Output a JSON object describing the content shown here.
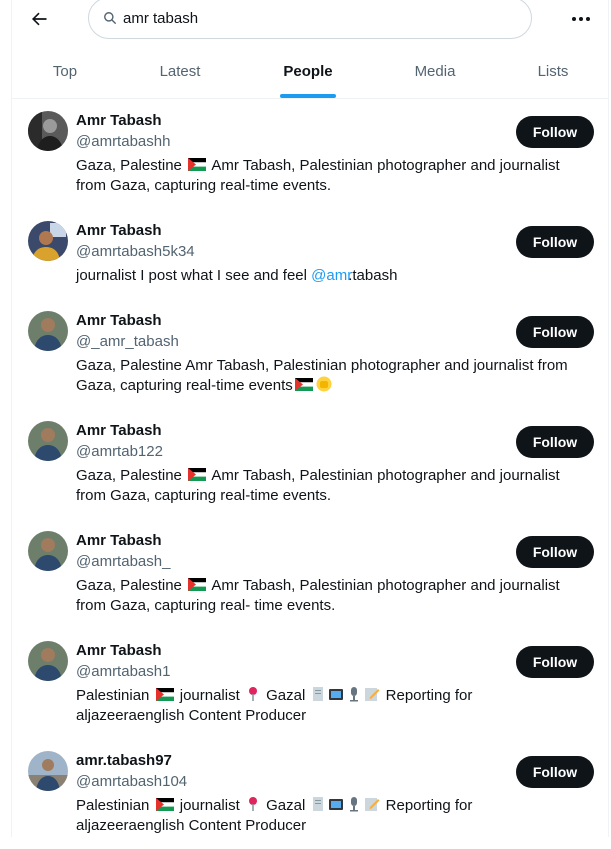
{
  "search": {
    "value": "amr tabash"
  },
  "tabs": [
    {
      "label": "Top",
      "active": false
    },
    {
      "label": "Latest",
      "active": false
    },
    {
      "label": "People",
      "active": true
    },
    {
      "label": "Media",
      "active": false
    },
    {
      "label": "Lists",
      "active": false
    }
  ],
  "colors": {
    "accent": "#1d9bf0",
    "text": "#0f1419",
    "muted": "#536471",
    "button": "#0f1419"
  },
  "icons": {
    "back": "arrow-left-icon",
    "search": "search-icon",
    "more": "more-horizontal-icon"
  },
  "people": [
    {
      "name": "Amr Tabash",
      "handle": "@amrtabashh",
      "button": "Follow",
      "bio_a": "Gaza, Palestine",
      "bio_b": "Amr Tabash, Palestinian photographer and journalist",
      "bio_c": "from Gaza, capturing real-time events."
    },
    {
      "name": "Amr Tabash",
      "handle": "@amrtabash5k34",
      "button": "Follow",
      "bio_a": "journalist I post what I see and feel",
      "bio_link": "@amr",
      "bio_b": ".tabash"
    },
    {
      "name": "Amr Tabash",
      "handle": "@_amr_tabash",
      "button": "Follow",
      "bio_a": "Gaza, Palestine Amr Tabash, Palestinian photographer and journalist from",
      "bio_c": "Gaza, capturing real-time events"
    },
    {
      "name": "Amr Tabash",
      "handle": "@amrtab122",
      "button": "Follow",
      "bio_a": "Gaza, Palestine",
      "bio_b": "Amr Tabash, Palestinian photographer and journalist",
      "bio_c": "from Gaza, capturing real-time events."
    },
    {
      "name": "Amr Tabash",
      "handle": "@amrtabash_",
      "button": "Follow",
      "bio_a": "Gaza, Palestine",
      "bio_b": "Amr Tabash, Palestinian photographer and journalist",
      "bio_c": "from Gaza, capturing real- time events."
    },
    {
      "name": "Amr Tabash",
      "handle": "@amrtabash1",
      "button": "Follow",
      "bio_a": "Palestinian",
      "bio_b": "journalist",
      "bio_c": "Gazal",
      "bio_d": "Reporting for",
      "bio_e": "aljazeeraenglish Content Producer"
    },
    {
      "name": "amr.tabash97",
      "handle": "@amrtabash104",
      "button": "Follow",
      "bio_a": "Palestinian",
      "bio_b": "journalist",
      "bio_c": "Gazal",
      "bio_d": "Reporting for",
      "bio_e": "aljazeeraenglish Content Producer"
    }
  ]
}
